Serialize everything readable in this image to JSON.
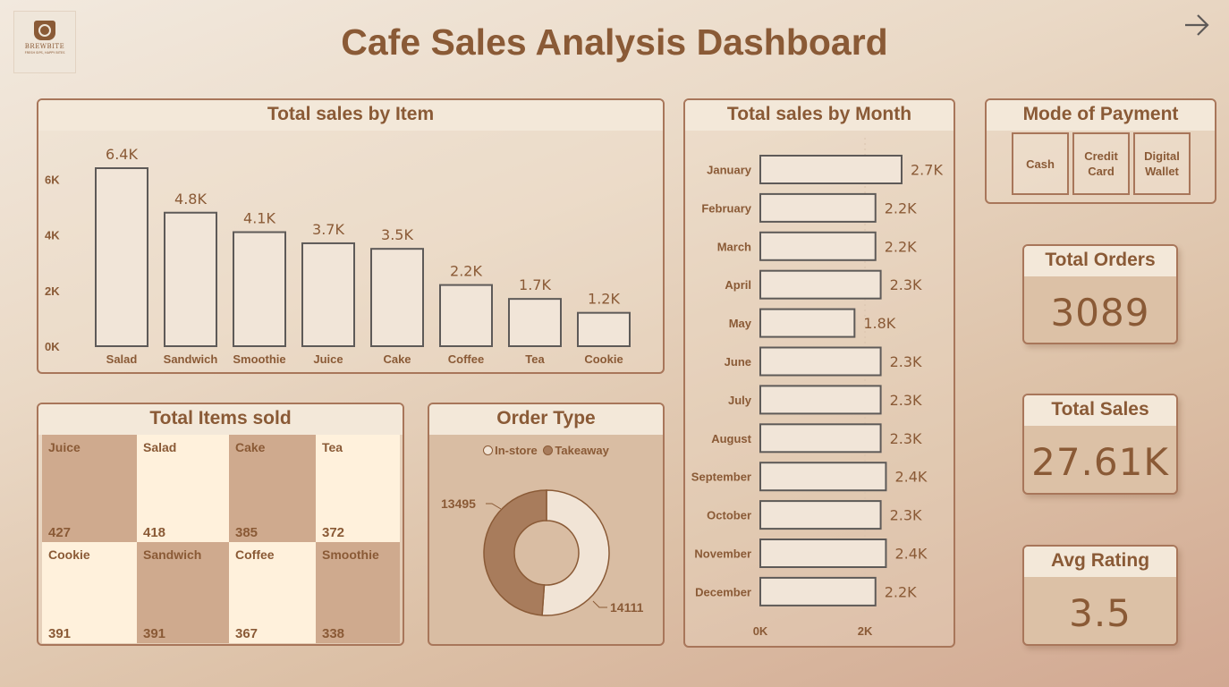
{
  "header": {
    "title": "Cafe Sales Analysis Dashboard",
    "logo": {
      "brand": "BREWBITE",
      "tagline": "FRESH SIPS, HAPPY BITES"
    }
  },
  "colors": {
    "accent": "#8a5a36",
    "border": "#a8765a",
    "bar_fill": "#f1e5d8",
    "bar_stroke": "#5e5a58",
    "tile_light": "#fff1dc",
    "tile_dark": "#cfaa8e",
    "donut_dark": "#a87c5c",
    "donut_light": "#f1e4d6"
  },
  "panels": {
    "items_title": "Total sales by Item",
    "month_title": "Total sales by Month",
    "payment_title": "Mode of Payment",
    "items_sold_title": "Total Items sold",
    "order_type_title": "Order Type"
  },
  "payment_modes": [
    "Cash",
    "Credit\nCard",
    "Digital\nWallet"
  ],
  "kpis": [
    {
      "title": "Total Orders",
      "value": "3089"
    },
    {
      "title": "Total Sales",
      "value": "27.61K"
    },
    {
      "title": "Avg Rating",
      "value": "3.5"
    }
  ],
  "chart_data": [
    {
      "type": "bar",
      "title": "Total sales by Item",
      "categories": [
        "Salad",
        "Sandwich",
        "Smoothie",
        "Juice",
        "Cake",
        "Coffee",
        "Tea",
        "Cookie"
      ],
      "values": [
        6400,
        4800,
        4100,
        3700,
        3500,
        2200,
        1700,
        1200
      ],
      "data_labels": [
        "6.4K",
        "4.8K",
        "4.1K",
        "3.7K",
        "3.5K",
        "2.2K",
        "1.7K",
        "1.2K"
      ],
      "yticks": [
        "0K",
        "2K",
        "4K",
        "6K"
      ],
      "ytick_values": [
        0,
        2000,
        4000,
        6000
      ],
      "ylim": [
        0,
        6400
      ]
    },
    {
      "type": "bar",
      "orientation": "horizontal",
      "title": "Total sales by Month",
      "categories": [
        "January",
        "February",
        "March",
        "April",
        "May",
        "June",
        "July",
        "August",
        "September",
        "October",
        "November",
        "December"
      ],
      "values": [
        2700,
        2200,
        2200,
        2300,
        1800,
        2300,
        2300,
        2300,
        2400,
        2300,
        2400,
        2200
      ],
      "data_labels": [
        "2.7K",
        "2.2K",
        "2.2K",
        "2.3K",
        "1.8K",
        "2.3K",
        "2.3K",
        "2.3K",
        "2.4K",
        "2.3K",
        "2.4K",
        "2.2K"
      ],
      "xticks": [
        "0K",
        "2K"
      ],
      "xtick_values": [
        0,
        2000
      ],
      "xlim": [
        0,
        2700
      ]
    },
    {
      "type": "table",
      "title": "Total Items sold",
      "rows": [
        [
          {
            "name": "Juice",
            "value": "427",
            "shade": "dark"
          },
          {
            "name": "Salad",
            "value": "418",
            "shade": "light"
          },
          {
            "name": "Cake",
            "value": "385",
            "shade": "dark"
          },
          {
            "name": "Tea",
            "value": "372",
            "shade": "light"
          }
        ],
        [
          {
            "name": "Cookie",
            "value": "391",
            "shade": "light"
          },
          {
            "name": "Sandwich",
            "value": "391",
            "shade": "dark"
          },
          {
            "name": "Coffee",
            "value": "367",
            "shade": "light"
          },
          {
            "name": "Smoothie",
            "value": "338",
            "shade": "dark"
          }
        ]
      ]
    },
    {
      "type": "pie",
      "title": "Order Type",
      "legend": [
        {
          "name": "In-store",
          "shade": "light"
        },
        {
          "name": "Takeaway",
          "shade": "dark"
        }
      ],
      "values": [
        14111,
        13495
      ],
      "data_labels": [
        "14111",
        "13495"
      ],
      "legend_position": "top"
    }
  ]
}
